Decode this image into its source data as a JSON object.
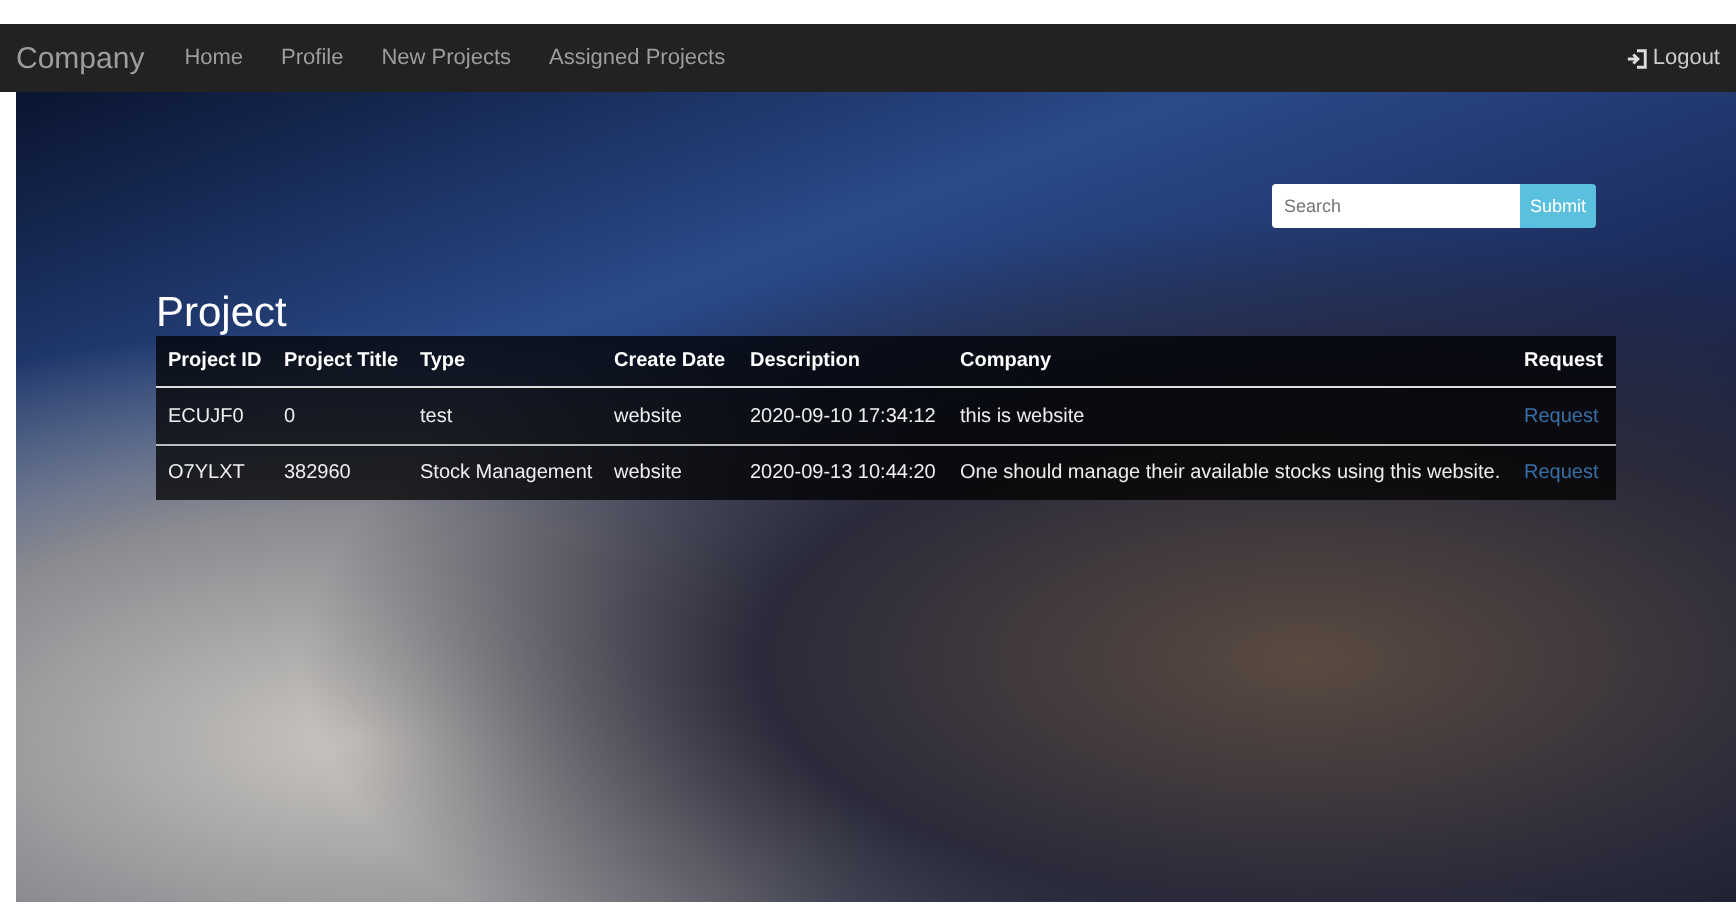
{
  "navbar": {
    "brand": "Company",
    "links": [
      {
        "label": "Home"
      },
      {
        "label": "Profile"
      },
      {
        "label": "New Projects"
      },
      {
        "label": "Assigned Projects"
      }
    ],
    "logout": "Logout"
  },
  "search": {
    "placeholder": "Search",
    "button": "Submit"
  },
  "heading": "Project",
  "table": {
    "columns": [
      "Project ID",
      "Project Title",
      "Type",
      "Create Date",
      "Description",
      "Company",
      "Request"
    ],
    "rows": [
      {
        "cells": [
          "ECUJF0",
          "0",
          "test",
          "website",
          "2020-09-10 17:34:12",
          "this is website"
        ],
        "action": "Request"
      },
      {
        "cells": [
          "O7YLXT",
          "382960",
          "Stock Management",
          "website",
          "2020-09-13 10:44:20",
          "One should manage their available stocks using this website."
        ],
        "action": "Request"
      }
    ]
  }
}
